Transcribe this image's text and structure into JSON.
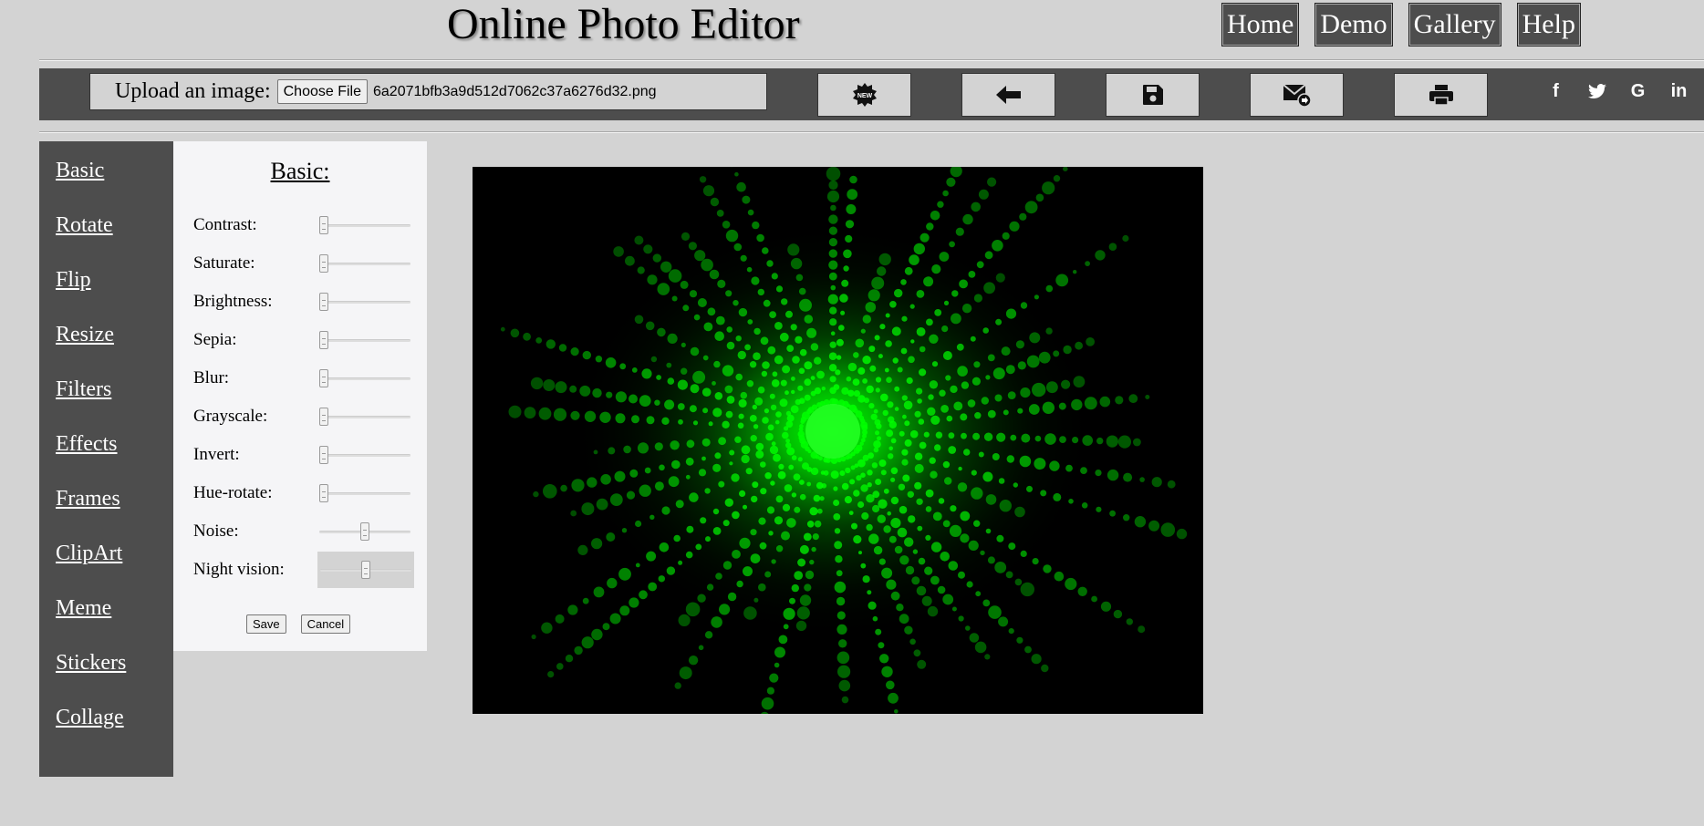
{
  "header": {
    "title": "Online Photo Editor",
    "nav": [
      "Home",
      "Demo",
      "Gallery",
      "Help"
    ]
  },
  "toolbar": {
    "upload_label": "Upload an image:",
    "choose_file_label": "Choose File",
    "file_name": "6a2071bfb3a9d512d7062c37a6276d32.png",
    "new_badge": "NEW",
    "social": [
      "f",
      "t",
      "G",
      "in"
    ]
  },
  "sidebar": {
    "items": [
      "Basic",
      "Rotate",
      "Flip",
      "Resize",
      "Filters",
      "Effects",
      "Frames",
      "ClipArt",
      "Meme",
      "Stickers",
      "Collage"
    ]
  },
  "panel": {
    "title": "Basic:",
    "controls": [
      {
        "label": "Contrast:",
        "value": 0
      },
      {
        "label": "Saturate:",
        "value": 0
      },
      {
        "label": "Brightness:",
        "value": 0
      },
      {
        "label": "Sepia:",
        "value": 0
      },
      {
        "label": "Blur:",
        "value": 0
      },
      {
        "label": "Grayscale:",
        "value": 0
      },
      {
        "label": "Invert:",
        "value": 0
      },
      {
        "label": "Hue-rotate:",
        "value": 0
      },
      {
        "label": "Noise:",
        "value": 0.5
      },
      {
        "label": "Night vision:",
        "value": 0.5
      }
    ],
    "save_label": "Save",
    "cancel_label": "Cancel"
  },
  "colors": {
    "bar": "#4d4d4d",
    "background": "#d3d3d3",
    "panel": "#f5f5f7",
    "burst": "#00ff00"
  },
  "icons": [
    "new-badge-icon",
    "undo-arrow-icon",
    "save-disk-icon",
    "email-icon",
    "printer-icon"
  ]
}
